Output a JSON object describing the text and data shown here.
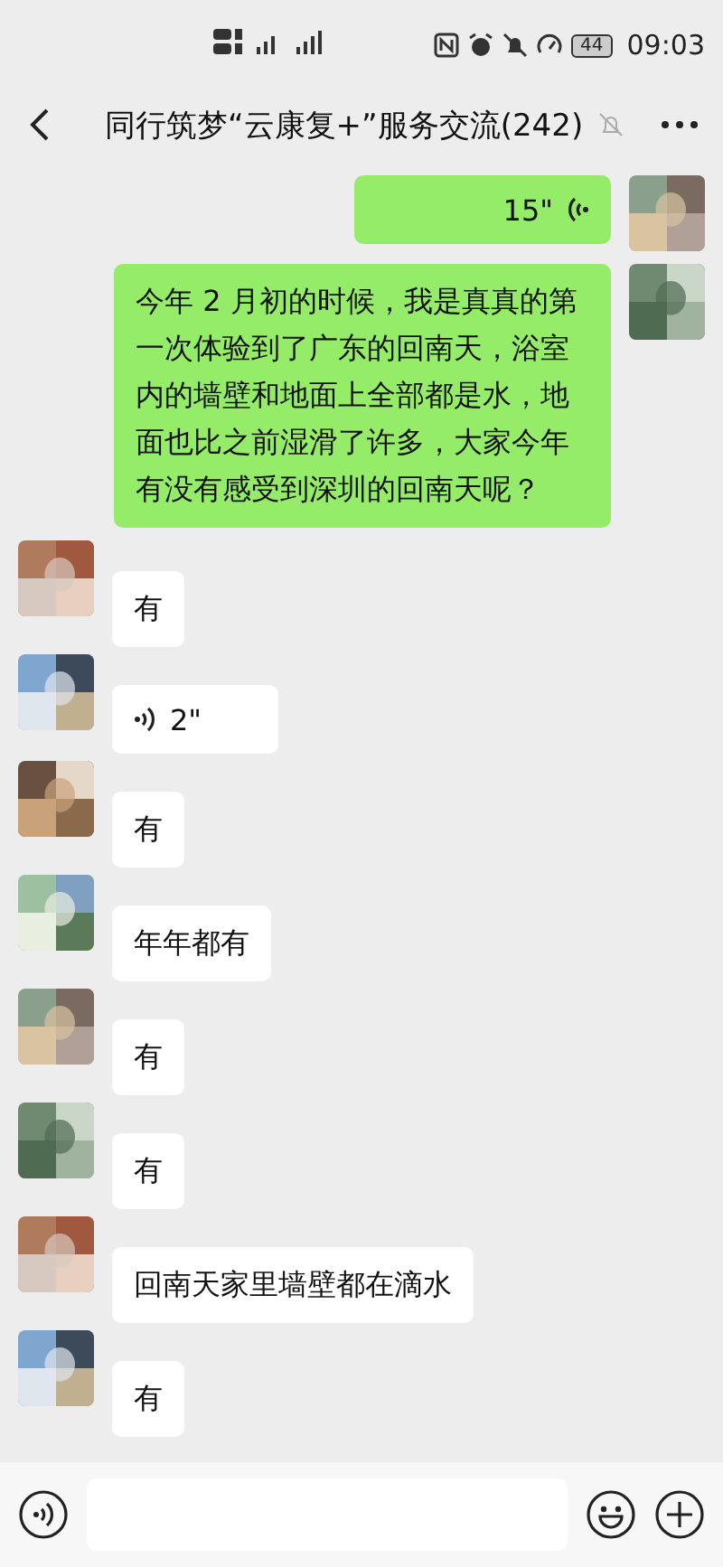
{
  "status_bar": {
    "battery": "44",
    "time": "09:03"
  },
  "header": {
    "title": "同行筑梦“云康复+”服务交流(242)",
    "muted": true
  },
  "messages": [
    {
      "kind": "voice",
      "outgoing": true,
      "duration": "15\""
    },
    {
      "kind": "text",
      "outgoing": true,
      "text": "今年 2 月初的时候，我是真真的第一次体验到了广东的回南天，浴室内的墙壁和地面上全部都是水，地面也比之前湿滑了许多，大家今年有没有感受到深圳的回南天呢？"
    },
    {
      "kind": "text",
      "outgoing": false,
      "text": "有"
    },
    {
      "kind": "voice",
      "outgoing": false,
      "duration": "2\""
    },
    {
      "kind": "text",
      "outgoing": false,
      "text": "有"
    },
    {
      "kind": "text",
      "outgoing": false,
      "text": "年年都有"
    },
    {
      "kind": "text",
      "outgoing": false,
      "text": "有"
    },
    {
      "kind": "text",
      "outgoing": false,
      "text": "有"
    },
    {
      "kind": "text",
      "outgoing": false,
      "text": "回南天家里墙壁都在滴水"
    },
    {
      "kind": "text",
      "outgoing": false,
      "text": "有"
    }
  ]
}
